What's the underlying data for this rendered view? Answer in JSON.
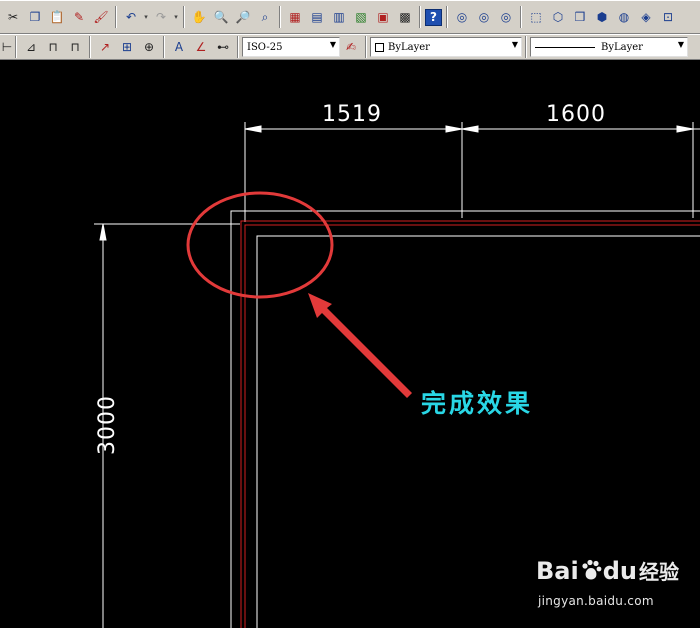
{
  "toolbar_standard": {
    "icons": [
      "cut-icon",
      "copy-icon",
      "paste-icon",
      "match-properties-icon",
      "paint-brush-icon",
      "undo-icon",
      "redo-icon",
      "pan-icon",
      "zoom-realtime-icon",
      "zoom-window-icon",
      "zoom-previous-icon",
      "properties-icon",
      "design-center-icon",
      "tool-palettes-icon",
      "sheet-set-icon",
      "markup-icon",
      "calculator-icon",
      "help-icon",
      "orbit-icon",
      "free-orbit-icon",
      "continuous-orbit-icon",
      "box-icon",
      "wedge-icon",
      "cube-icon",
      "cylinder-icon",
      "sphere-icon",
      "torus-icon",
      "view-icon"
    ],
    "help_label": "?"
  },
  "toolbar_dimension": {
    "dim_style": "ISO-25",
    "layer": "ByLayer",
    "linetype": "ByLayer"
  },
  "drawing": {
    "dimensions": {
      "top_left": "1519",
      "top_right": "1600",
      "left_vertical": "3000"
    },
    "annotation": "完成效果",
    "colors": {
      "background": "#000000",
      "dimension_lines": "#ffffff",
      "wall_red": "#d22020",
      "highlight_circle": "#e23a3a",
      "annotation_text": "#29d7e6"
    }
  },
  "watermark": {
    "logo_prefix": "Bai",
    "logo_suffix": "du",
    "brand": "经验",
    "url": "jingyan.baidu.com"
  }
}
